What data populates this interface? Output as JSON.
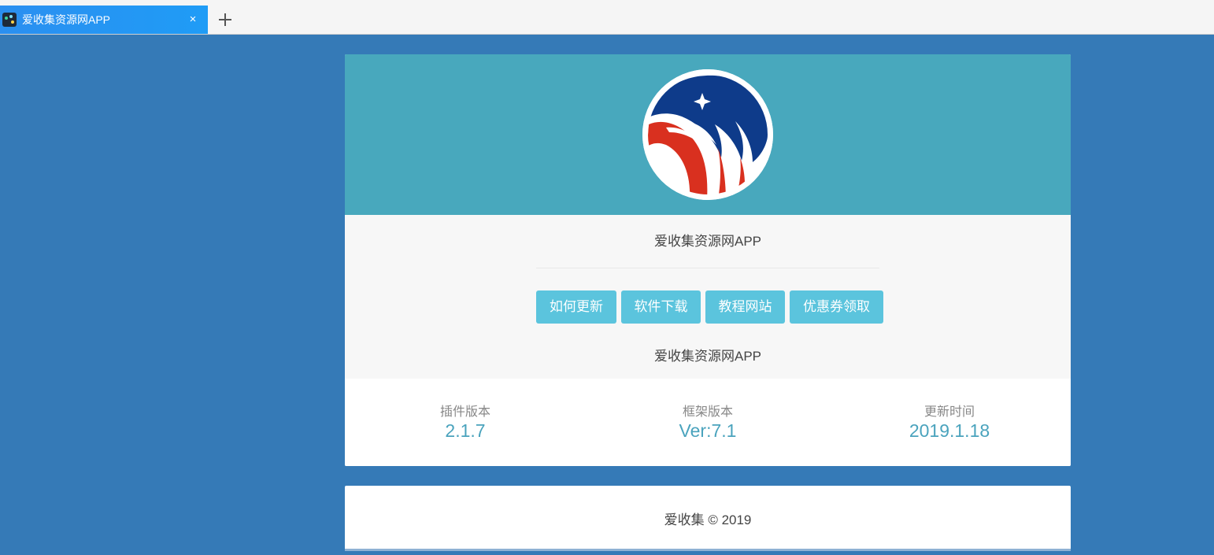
{
  "browser": {
    "tab": {
      "title": "爱收集资源网APP",
      "close_label": "×"
    },
    "new_tab_label": "+"
  },
  "header": {
    "logo_name": "app-logo"
  },
  "main": {
    "app_name_top": "爱收集资源网APP",
    "app_name_bottom": "爱收集资源网APP",
    "buttons": [
      {
        "label": "如何更新"
      },
      {
        "label": "软件下载"
      },
      {
        "label": "教程网站"
      },
      {
        "label": "优惠券领取"
      }
    ],
    "stats": [
      {
        "label": "插件版本",
        "value": "2.1.7"
      },
      {
        "label": "框架版本",
        "value": "Ver:7.1"
      },
      {
        "label": "更新时间",
        "value": "2019.1.18"
      }
    ]
  },
  "footer": {
    "text": "爱收集 © 2019"
  },
  "colors": {
    "page_background": "#357ab7",
    "header_band": "#48a8bd",
    "button": "#5bc4dd",
    "stat_value": "#4aa3bd",
    "tab_active": "#2b8ff0"
  }
}
